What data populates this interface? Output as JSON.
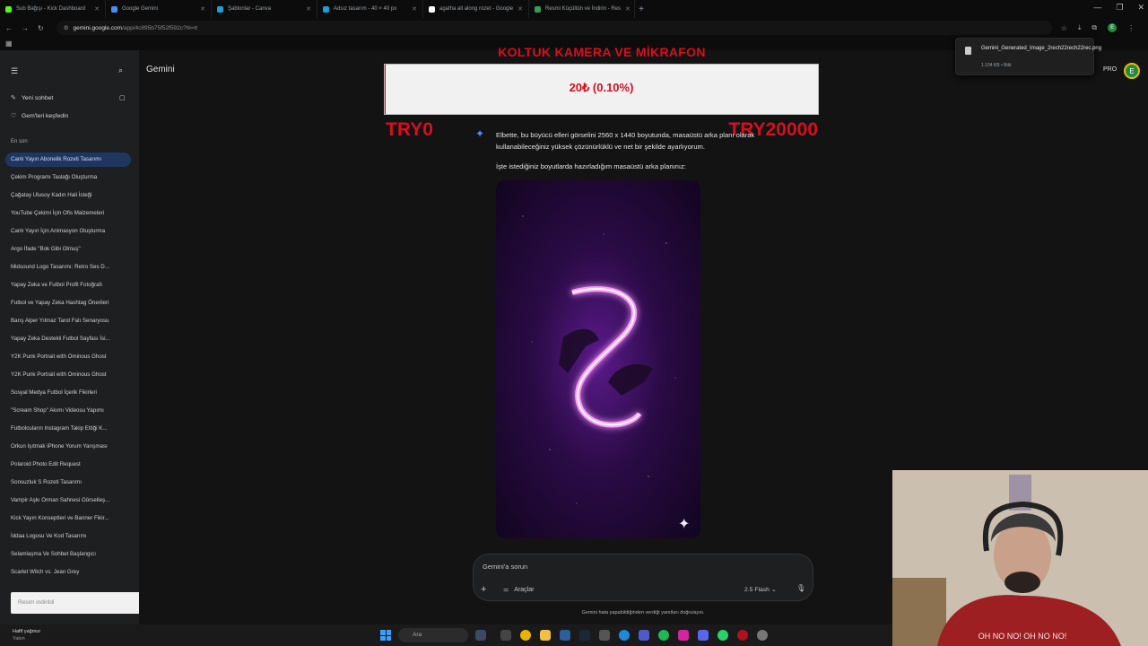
{
  "browser": {
    "tabs": [
      {
        "title": "Sub Bağışı - Kick Dashboard",
        "color": "#53fc18"
      },
      {
        "title": "Google Gemini",
        "color": "#4e8cf5"
      },
      {
        "title": "Şablonlar - Canva",
        "color": "#1aa1d6"
      },
      {
        "title": "Adsız tasarım - 40 × 40 px",
        "color": "#1aa1d6"
      },
      {
        "title": "agatha all along rozet - Google",
        "color": "#ffffff"
      },
      {
        "title": "Resmi Küçültün ve İndirin - Res",
        "color": "#3c9a5f"
      }
    ],
    "new_tab": "+",
    "url_host": "gemini.google.com",
    "url_path": "/app/4c895b75f52f592c?hl=tr"
  },
  "download": {
    "filename": "Gemini_Generated_Image_2rech22rech22rec.png",
    "size": "1.104 KB • Bitti"
  },
  "sidebar": {
    "new_chat": "Yeni sohbet",
    "explore_gems": "Gem'leri keşfedin",
    "recent_header": "En son",
    "recent": [
      "Canlı Yayın Abonelik Rozeti Tasarımı",
      "Çekim Programı Taslağı Oluşturma",
      "Çağatay Ulusoy Kadın Hali İsteği",
      "YouTube Çekimi İçin Ofis Malzemeleri",
      "Canlı Yayın İçin Animasyon Oluşturma",
      "Argo İfade \"Bok Gibi Olmuş\"",
      "Midsound Logo Tasarımı: Retro Ses D...",
      "Yapay Zeka ve Futbol Profil Fotoğrafı",
      "Futbol ve Yapay Zeka Hashtag Önerileri",
      "Barış Alper Yılmaz Tarot Falı Senaryosu",
      "Yapay Zeka Destekli Futbol Sayfası İsi...",
      "Y2K Punk Portrait with Ominous Ghost",
      "Y2K Punk Portrait with Ominous Ghost",
      "Sosyal Medya Futbol İçerik Fikirleri",
      "\"Scream Shop\" Akımı Videosu Yapımı",
      "Futbolcuların Instagram Takip Ettiği K...",
      "Orkun Işıtmak iPhone Yorum Yarışması",
      "Polaroid Photo Edit Request",
      "Sonsuzluk S Rozeti Tasarımı",
      "Vampir Aşkı Orman Sahnesi Görselleş...",
      "Kick Yayın Konseptleri ve Banner Fikir...",
      "İddaa Logosu Ve Kod Tasarımı",
      "Selamlaşma Ve Sohbet Başlangıcı",
      "Scarlet Witch vs. Jean Grey"
    ],
    "toast": "Resim indirildi"
  },
  "header": {
    "title": "Gemini",
    "pro": "PRO",
    "avatar_letter": "E"
  },
  "overlay": {
    "title": "KOLTUK KAMERA VE MİKRAFON",
    "progress_text": "20₺ (0.10%)",
    "progress_fraction": 0.001,
    "min_label": "TRY0",
    "max_label": "TRY20000",
    "color": "#d5101d"
  },
  "response": {
    "para1": "Elbette, bu büyücü elleri görselini 2560 x 1440 boyutunda, masaüstü arka planı olarak kullanabileceğiniz yüksek çözünürlüklü ve net bir şekilde ayarlıyorum.",
    "para2": "İşte istediğiniz boyutlarda hazırladığım masaüstü arka planınız:"
  },
  "prompt": {
    "placeholder": "Gemini'a sorun",
    "tools": "Araçlar",
    "model": "2.5 Flash",
    "disclaimer": "Gemini hata yapabildiğinden verdiği yanıtları doğrulayın."
  },
  "taskbar": {
    "weather_line1": "Hafif yağmur",
    "weather_line2": "Yakın",
    "search": "Ara"
  },
  "webcam": {
    "sweater_text": "OH NO NO! OH NO NO!"
  }
}
